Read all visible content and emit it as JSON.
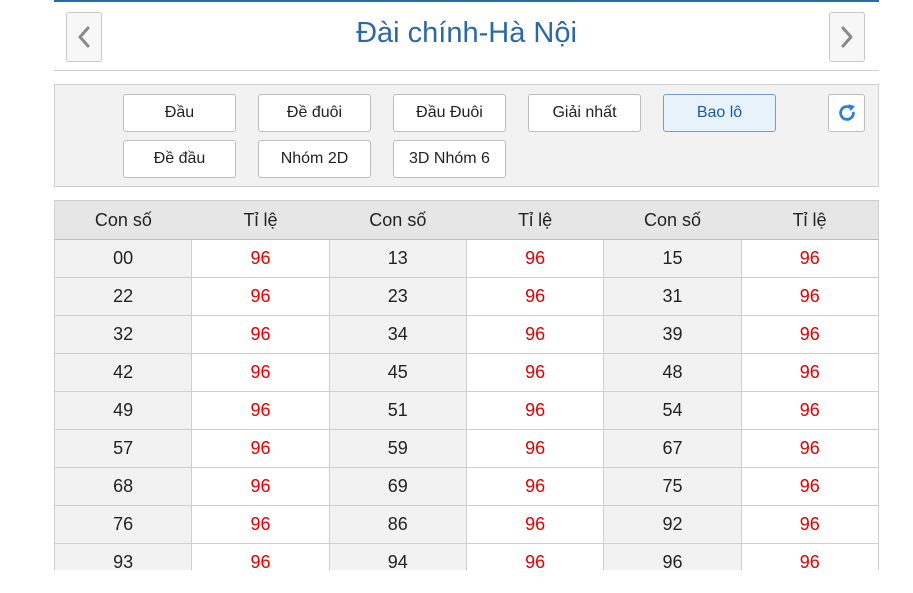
{
  "header": {
    "title": "Đài chính-Hà Nội",
    "prev_icon": "chevron-left-icon",
    "next_icon": "chevron-right-icon"
  },
  "filters": {
    "row1": [
      "Đầu",
      "Đề đuôi",
      "Đầu Đuôi",
      "Giải nhất",
      "Bao lô"
    ],
    "row2": [
      "Đề đầu",
      "Nhóm 2D",
      "3D Nhóm 6"
    ],
    "active": "Bao lô",
    "refresh_icon": "refresh-icon"
  },
  "table": {
    "headers": [
      "Con số",
      "Tỉ lệ",
      "Con số",
      "Tỉ lệ",
      "Con số",
      "Tỉ lệ"
    ],
    "rows": [
      [
        "00",
        "96",
        "13",
        "96",
        "15",
        "96"
      ],
      [
        "22",
        "96",
        "23",
        "96",
        "31",
        "96"
      ],
      [
        "32",
        "96",
        "34",
        "96",
        "39",
        "96"
      ],
      [
        "42",
        "96",
        "45",
        "96",
        "48",
        "96"
      ],
      [
        "49",
        "96",
        "51",
        "96",
        "54",
        "96"
      ],
      [
        "57",
        "96",
        "59",
        "96",
        "67",
        "96"
      ],
      [
        "68",
        "96",
        "69",
        "96",
        "75",
        "96"
      ],
      [
        "76",
        "96",
        "86",
        "96",
        "92",
        "96"
      ],
      [
        "93",
        "96",
        "94",
        "96",
        "96",
        "96"
      ]
    ]
  },
  "colors": {
    "accent": "#2c67a8",
    "rate": "#e00000",
    "active_button_bg": "#e7f2fb"
  }
}
